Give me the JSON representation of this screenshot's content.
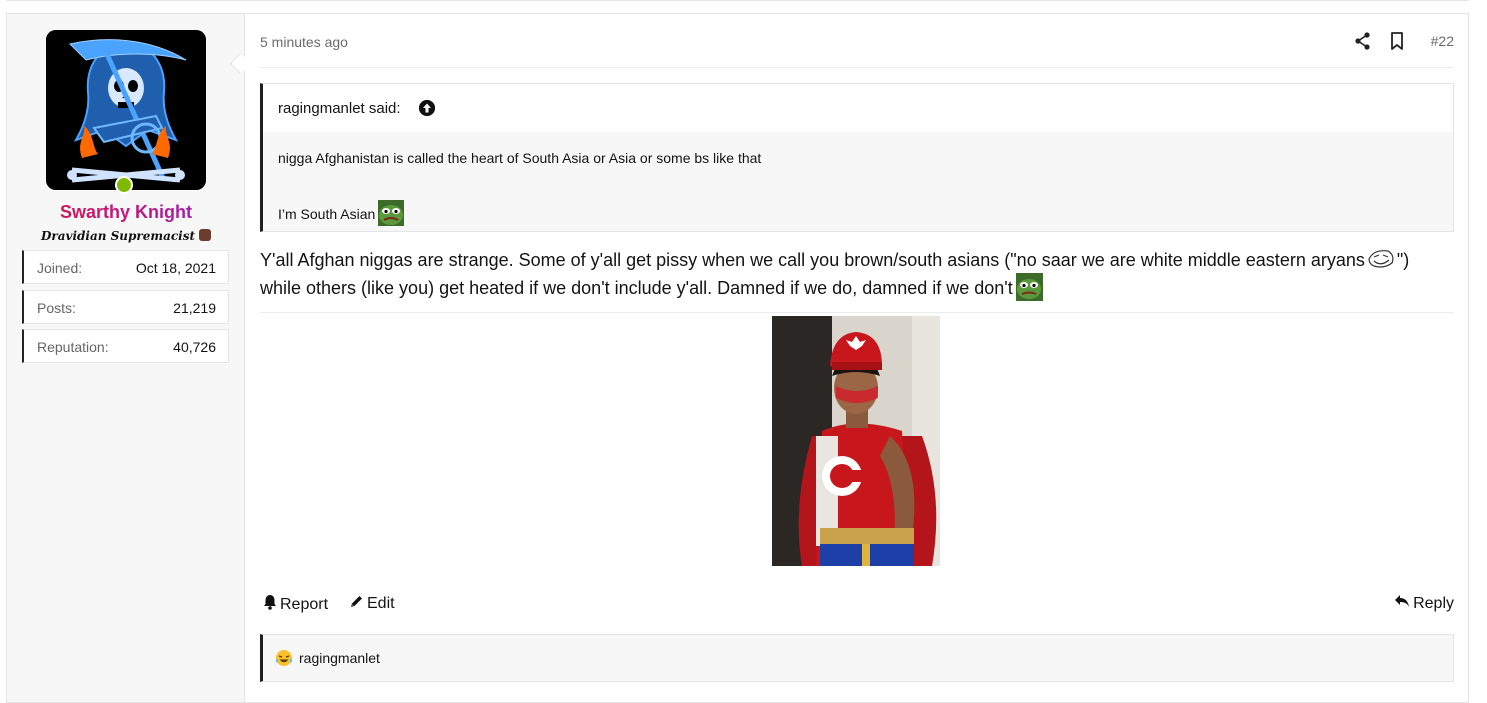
{
  "user": {
    "name": "Swarthy Knight",
    "title": "Dravidian Supremacist",
    "stats": [
      {
        "label": "Joined:",
        "value": "Oct 18, 2021"
      },
      {
        "label": "Posts:",
        "value": "21,219"
      },
      {
        "label": "Reputation:",
        "value": "40,726"
      }
    ],
    "online": true
  },
  "post": {
    "time": "5 minutes ago",
    "number": "#22",
    "quote": {
      "author": "ragingmanlet said:",
      "line1": "nigga Afghanistan is called the heart of South Asia or Asia or some bs like that",
      "line2": "I’m South Asian"
    },
    "body": {
      "part1": "Y'all Afghan niggas are strange. Some of y'all get pissy when we call you brown/south asians (\"no saar we are white middle eastern aryans",
      "part2": "\") while others (like you) get heated if we don't include y'all. Damned if we do, damned if we don't"
    },
    "actions": {
      "report": "Report",
      "edit": "Edit",
      "reply": "Reply"
    },
    "reactions": {
      "user": "ragingmanlet"
    }
  },
  "colors": {
    "accent_border": "#1f1f1f",
    "online": "#7fba00",
    "username_gradient_start": "#e0103a",
    "username_gradient_end": "#8a21d6"
  }
}
